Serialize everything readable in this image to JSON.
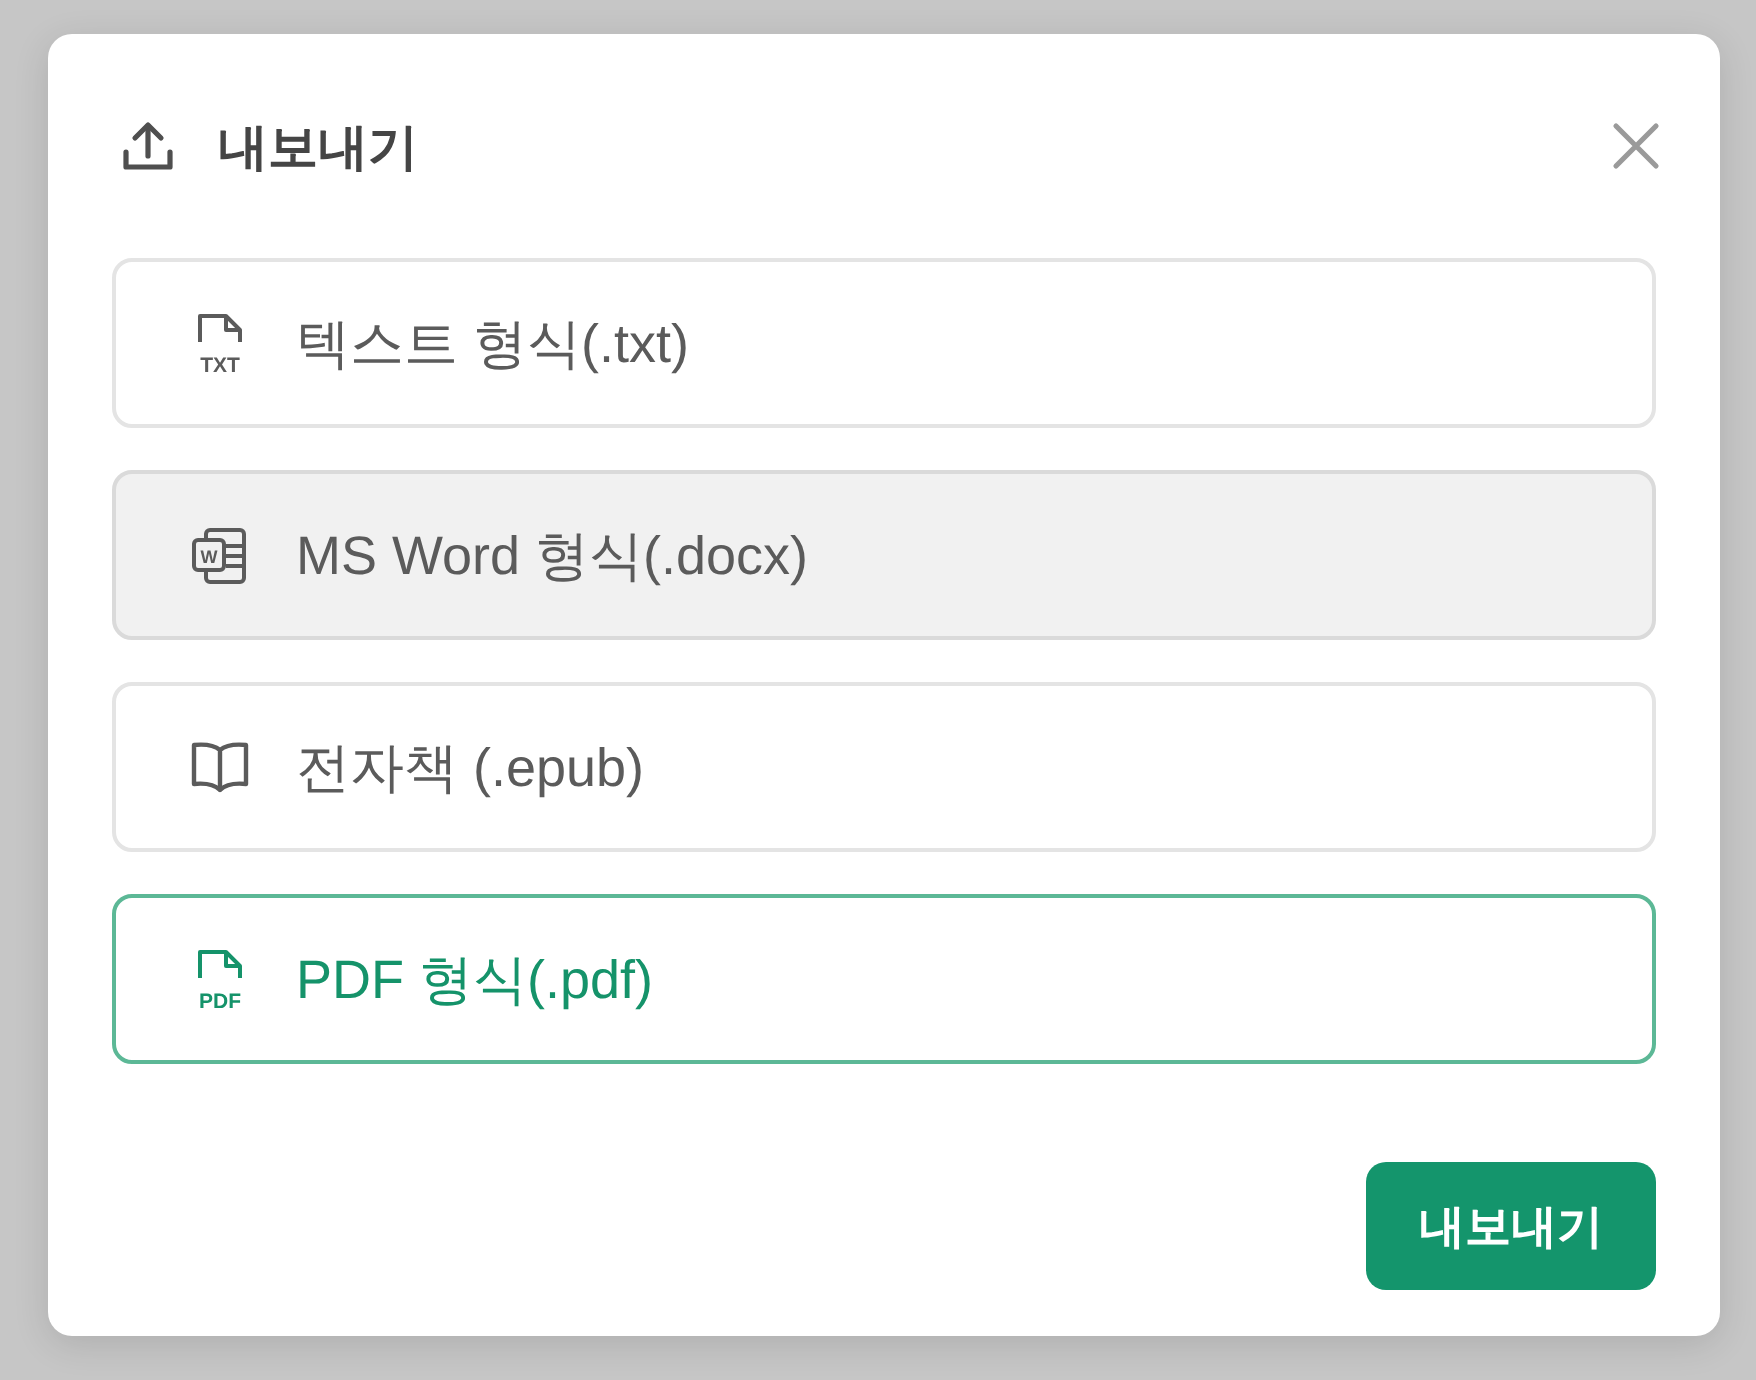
{
  "dialog": {
    "title": "내보내기"
  },
  "options": [
    {
      "kind": "txt",
      "icon_text": "TXT",
      "label": "텍스트 형식(.txt)",
      "selected": false,
      "hovered": false
    },
    {
      "kind": "docx",
      "icon_text": "W",
      "label": "MS Word 형식(.docx)",
      "selected": false,
      "hovered": true
    },
    {
      "kind": "epub",
      "label": "전자책 (.epub)",
      "selected": false,
      "hovered": false
    },
    {
      "kind": "pdf",
      "icon_text": "PDF",
      "label": "PDF 형식(.pdf)",
      "selected": true,
      "hovered": false
    }
  ],
  "export_button": {
    "label": "내보내기"
  }
}
